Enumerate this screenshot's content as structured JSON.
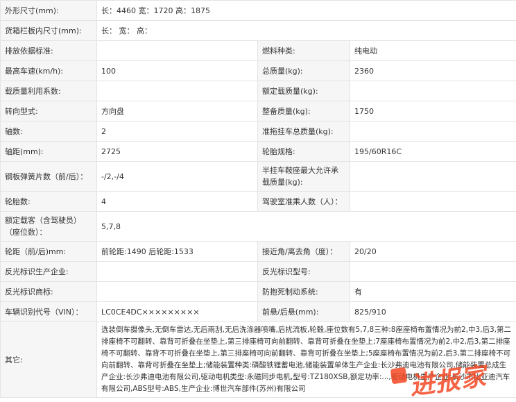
{
  "rows": {
    "dims": {
      "label": "外形尺寸(mm):",
      "value": "长：4460 宽：1720 高：1875"
    },
    "cargo": {
      "label": "货箱栏板内尺寸(mm):",
      "value": "长： 宽： 高："
    },
    "emission": {
      "label": "排放依据标准:",
      "value": "",
      "label2": "燃料种类:",
      "value2": "纯电动"
    },
    "speed": {
      "label": "最高车速(km/h):",
      "value": "100",
      "label2": "总质量(kg):",
      "value2": "2360"
    },
    "loadcoef": {
      "label": "载质量利用系数:",
      "value": "",
      "label2": "额定载质量(kg):",
      "value2": ""
    },
    "steering": {
      "label": "转向型式:",
      "value": "方向盘",
      "label2": "整备质量(kg):",
      "value2": "1750"
    },
    "axles": {
      "label": "轴数:",
      "value": "2",
      "label2": "准拖挂车总质量(kg):",
      "value2": ""
    },
    "wheelbase": {
      "label": "轴距(mm):",
      "value": "2725",
      "label2": "轮胎规格:",
      "value2": "195/60R16C"
    },
    "springs": {
      "label": "钢板弹簧片数（前/后）：",
      "value": "-/2,-/4",
      "label2": "半挂车鞍座最大允许承载质量(kg):",
      "value2": ""
    },
    "tires": {
      "label": "轮胎数:",
      "value": "4",
      "label2": "驾驶室准乘人数（人）：",
      "value2": ""
    },
    "seats": {
      "label": "额定载客（含驾驶员）（座位数）：",
      "value": "5,7,8"
    },
    "track": {
      "label": "轮距（前/后)mm:",
      "value": "前轮距:1490 后轮距:1533",
      "label2": "接近角/离去角（度）：",
      "value2": "20/20"
    },
    "reflmaker": {
      "label": "反光标识生产企业:",
      "value": "",
      "label2": "反光标识型号:",
      "value2": ""
    },
    "reflbrand": {
      "label": "反光标识商标:",
      "value": "",
      "label2": "防抱死制动系统:",
      "value2": "有"
    },
    "vin": {
      "label": "车辆识别代号（VIN）：",
      "value": "LC0CE4DC×××××××××",
      "label2": "前悬/后悬(mm):",
      "value2": "825/910"
    },
    "other": {
      "label": "其它:",
      "value": "选装倒车摄像头,无倒车雷达,无后雨刮,无后洗涤器喷嘴,后扰流板,轮毂,座位数有5,7,8三种:8座座椅布置情况为前2,中3,后3,第二排座椅不可翻转、靠背可折叠在坐垫上,第三排座椅可向前翻转、靠背可折叠在坐垫上;7座座椅布置情况为前2,中2,后3,第二排座椅不可翻转、靠背不可折叠在坐垫上,第三排座椅可向前翻转、靠背可折叠在坐垫上;5座座椅布置情况为前2,后3,第二排座椅不可向前翻转、靠背可折叠在坐垫上;储能装置种类:磷酸铁锂蓄电池,储能装置单体生产企业:长沙弗迪电池有限公司,储能装置总成生产企业:长沙弗迪电池有限公司,驱动电机类型:永磁同步电机,型号:TZ180XSB,额定功率:...,驱动电机生产企业:长沙市比亚迪汽车有限公司,ABS型号:ABS,生产企业:博世汽车部件(苏州)有限公司"
    }
  },
  "watermark": {
    "text": "进报家"
  },
  "colors": {
    "label_bg": "#f6f6f6",
    "border": "#e4e4e4",
    "watermark": "#f2421c"
  }
}
